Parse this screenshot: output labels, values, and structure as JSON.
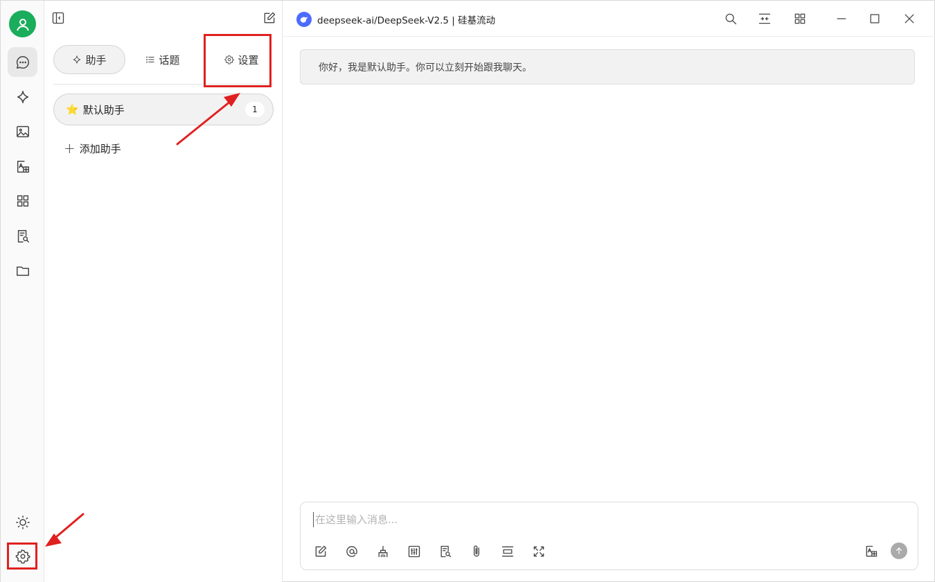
{
  "app": {
    "model_title": "deepseek-ai/DeepSeek-V2.5 | 硅基流动"
  },
  "rail": {
    "items": [
      {
        "name": "chat",
        "icon": "chat-bubble-icon",
        "active": true
      },
      {
        "name": "agents",
        "icon": "sparkle-icon",
        "active": false
      },
      {
        "name": "image",
        "icon": "image-icon",
        "active": false
      },
      {
        "name": "translate",
        "icon": "translate-icon",
        "active": false
      },
      {
        "name": "apps",
        "icon": "grid-icon",
        "active": false
      },
      {
        "name": "knowledge",
        "icon": "doc-search-icon",
        "active": false
      },
      {
        "name": "files",
        "icon": "folder-icon",
        "active": false
      }
    ],
    "bottom": [
      {
        "name": "theme",
        "icon": "sun-icon"
      },
      {
        "name": "settings",
        "icon": "gear-icon"
      }
    ]
  },
  "panel": {
    "tabs": [
      {
        "label": "助手",
        "icon": "sparkle-icon",
        "active": true
      },
      {
        "label": "话题",
        "icon": "list-icon",
        "active": false
      },
      {
        "label": "设置",
        "icon": "gear-icon",
        "active": false
      }
    ],
    "assistant": {
      "emoji": "⭐",
      "label": "默认助手",
      "count": "1"
    },
    "add_label": "添加助手"
  },
  "chat": {
    "greeting": "你好，我是默认助手。你可以立刻开始跟我聊天。"
  },
  "composer": {
    "placeholder": "在这里输入消息..."
  },
  "colors": {
    "accent_green": "#1aad5c",
    "annotation_red": "#e02020",
    "deepseek_blue": "#4d6bfe"
  }
}
